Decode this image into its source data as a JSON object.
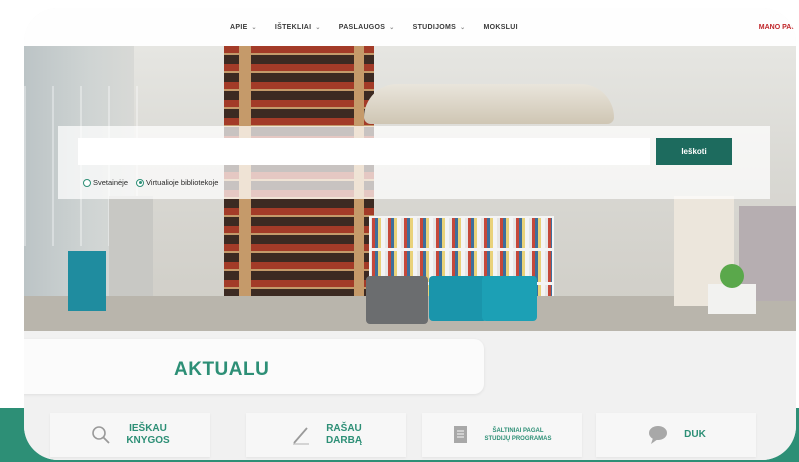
{
  "nav": {
    "items": [
      {
        "label": "APIE",
        "has_dropdown": true
      },
      {
        "label": "IŠTEKLIAI",
        "has_dropdown": true
      },
      {
        "label": "PASLAUGOS",
        "has_dropdown": true
      },
      {
        "label": "STUDIJOMS",
        "has_dropdown": true
      },
      {
        "label": "MOKSLUI",
        "has_dropdown": false
      }
    ],
    "account_label": "MANO PAS",
    "chevron": "⌄"
  },
  "search": {
    "value": "",
    "button_label": "Ieškoti",
    "scope_options": [
      {
        "label": "Svetainėje",
        "selected": false
      },
      {
        "label": "Virtualioje bibliotekoje",
        "selected": true
      }
    ]
  },
  "news": {
    "title": "AKTUALU"
  },
  "quick_links": [
    {
      "label": "IEŠKAU\nKNYGOS",
      "icon": "magnifier-icon"
    },
    {
      "label": "RAŠAU\nDARBĄ",
      "icon": "pen-icon"
    },
    {
      "label": "ŠALTINIAI PAGAL\nSTUDIJŲ PROGRAMAS",
      "icon": "document-icon"
    },
    {
      "label": "DUK",
      "icon": "chat-bubble-icon"
    }
  ],
  "colors": {
    "accent": "#2d8f76",
    "button": "#1d6b5e",
    "account": "#c0262a"
  }
}
